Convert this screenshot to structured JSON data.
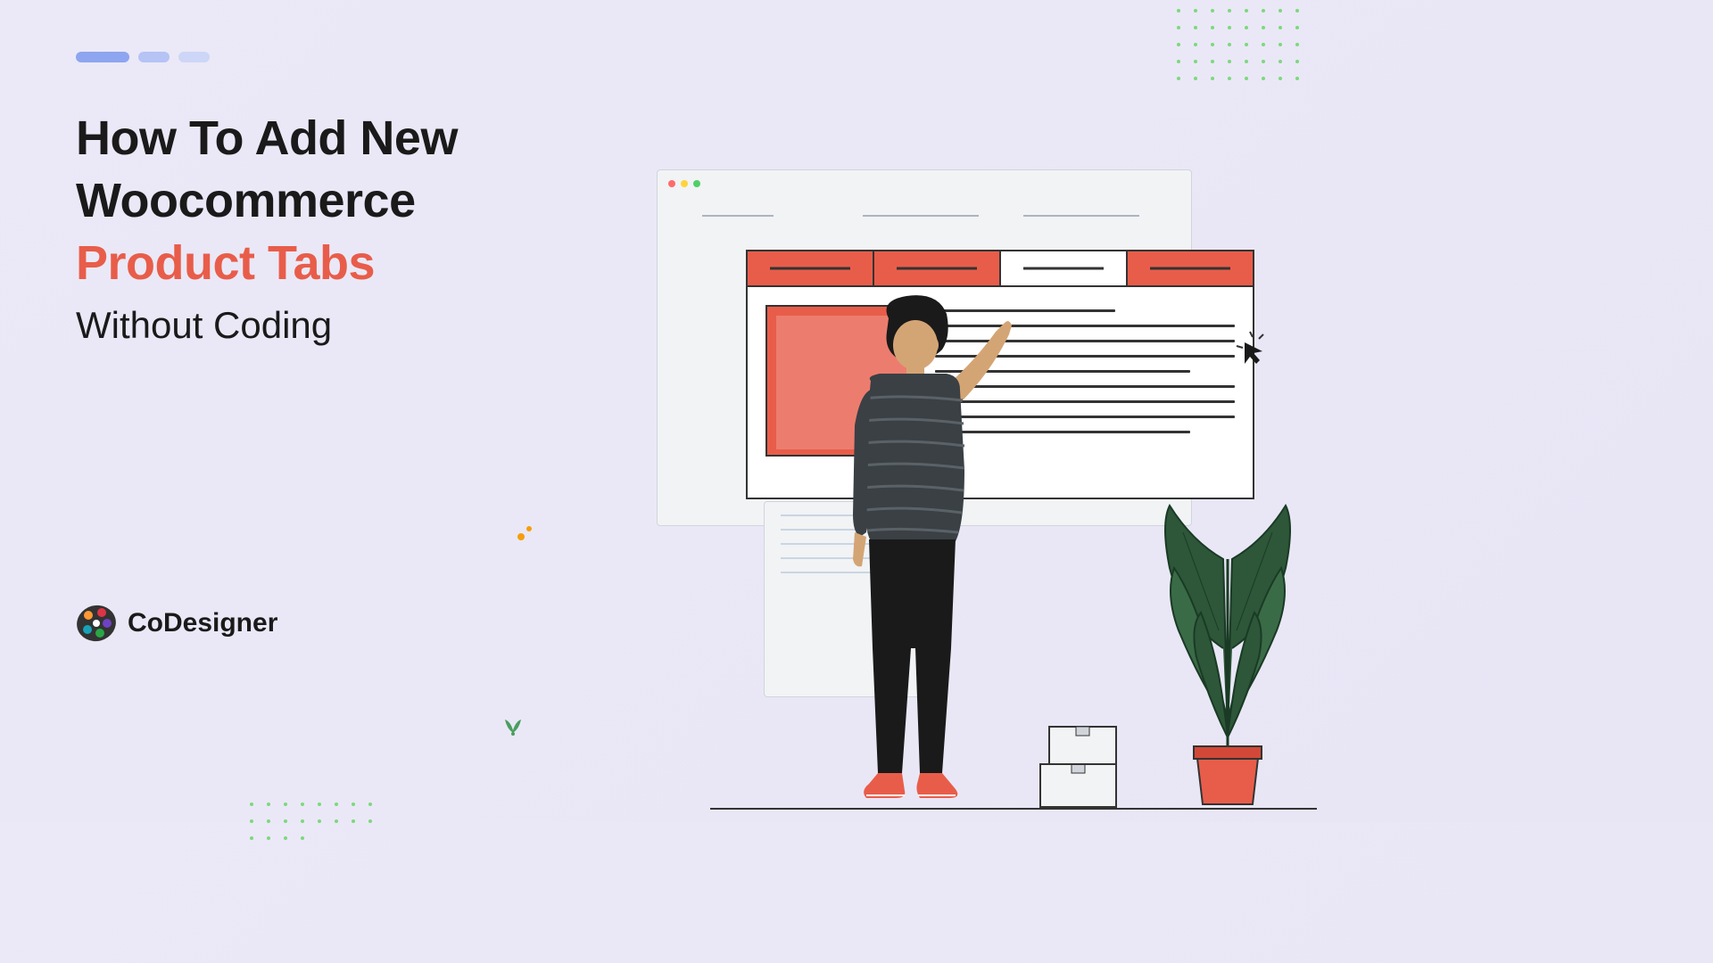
{
  "heading": {
    "line1": "How To Add New",
    "line2": "Woocommerce",
    "accent": "Product Tabs",
    "sub": "Without Coding"
  },
  "logo": {
    "text": "CoDesigner"
  }
}
